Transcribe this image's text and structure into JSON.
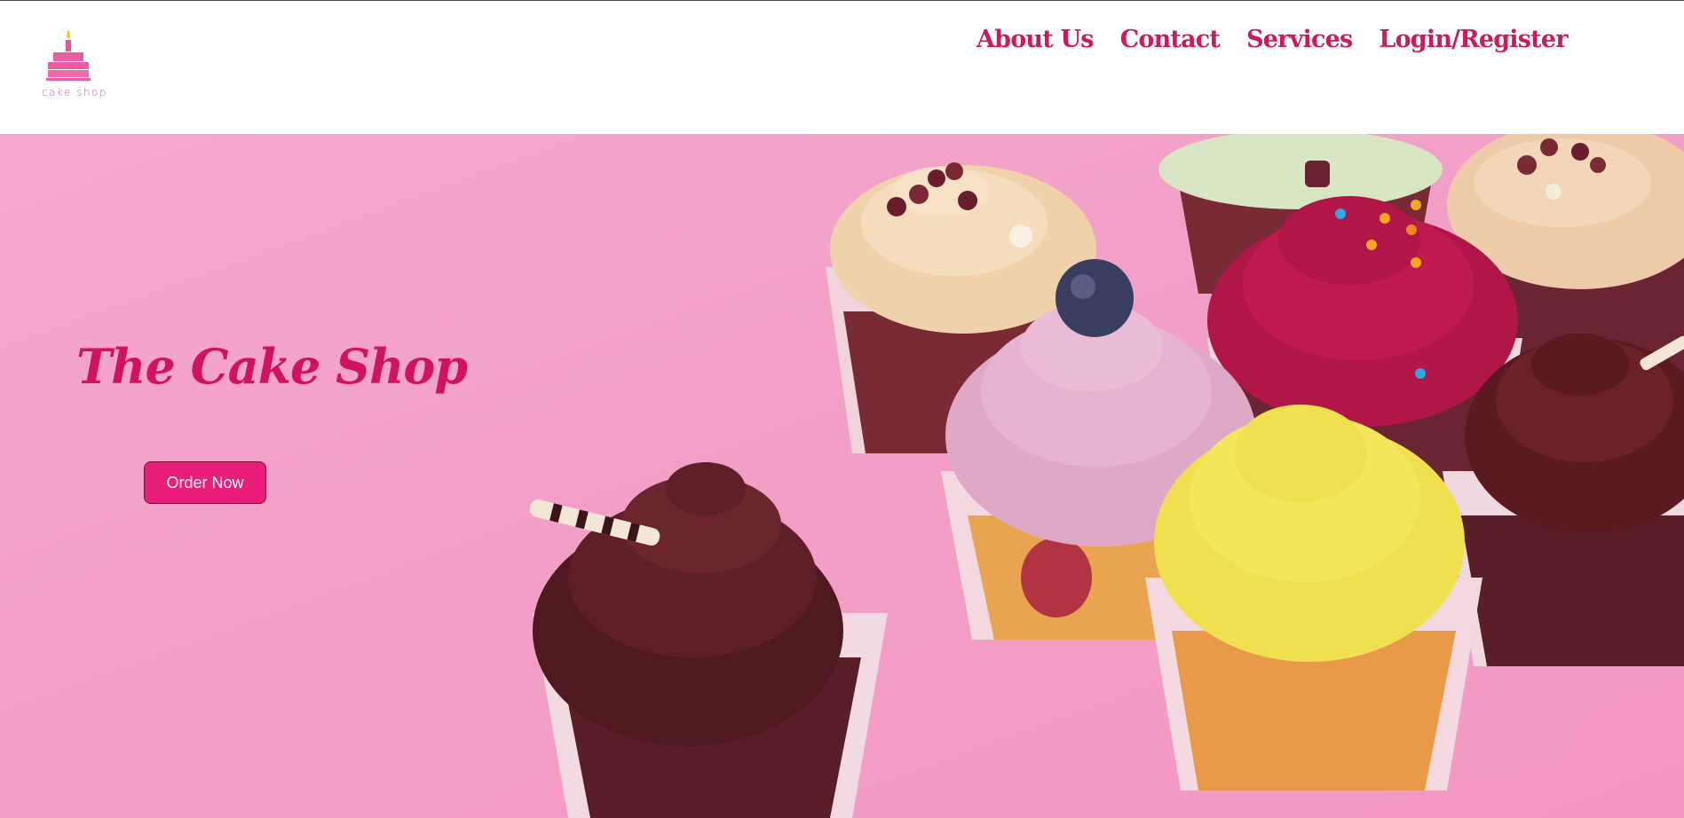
{
  "brand": {
    "logo_text": "cake shop",
    "logo_icon": "cake-icon"
  },
  "nav": {
    "items": [
      {
        "label": "About Us"
      },
      {
        "label": "Contact"
      },
      {
        "label": "Services"
      },
      {
        "label": "Login/Register"
      }
    ]
  },
  "hero": {
    "title": "The Cake Shop",
    "cta_label": "Order Now",
    "image": "cupcakes-photo"
  },
  "colors": {
    "accent": "#d0135e",
    "button": "#e91e7a",
    "hero_background": "#f4a2cb"
  }
}
